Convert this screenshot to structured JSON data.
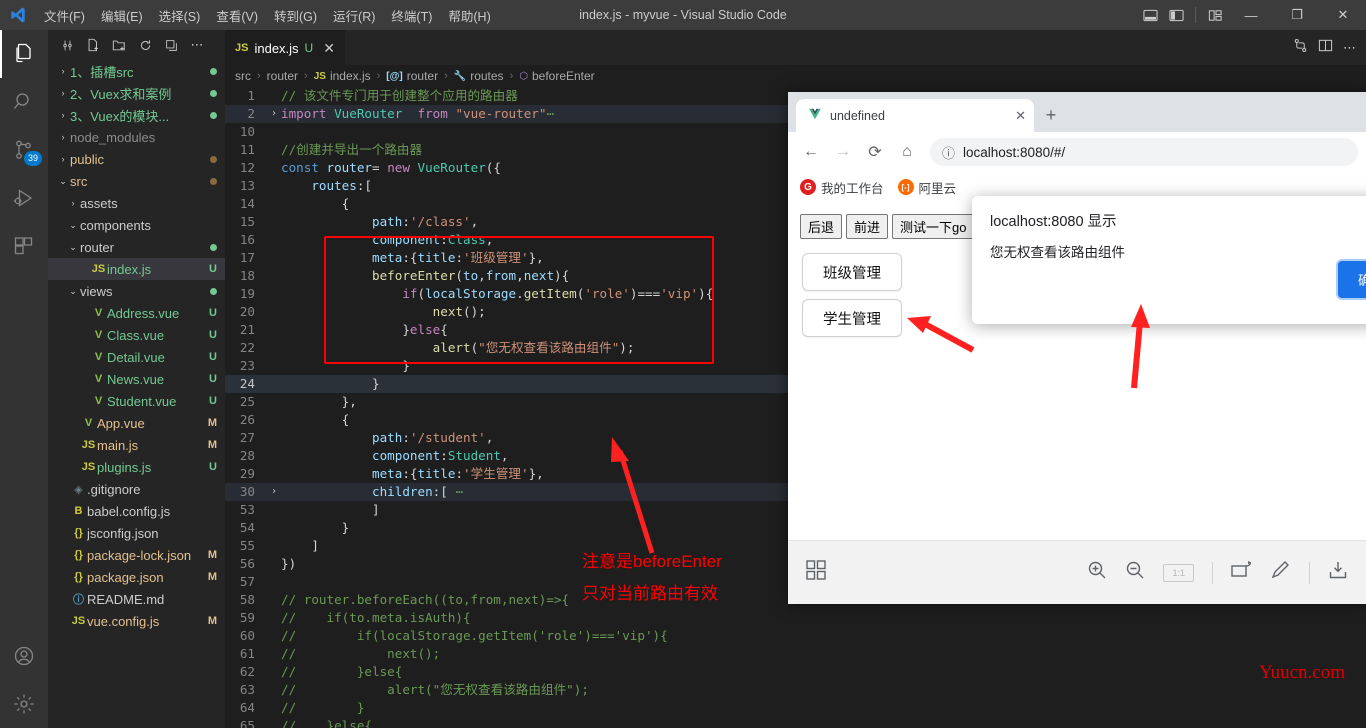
{
  "window": {
    "title": "index.js - myvue - Visual Studio Code",
    "menu": [
      "文件(F)",
      "编辑(E)",
      "选择(S)",
      "查看(V)",
      "转到(G)",
      "运行(R)",
      "终端(T)",
      "帮助(H)"
    ],
    "controls": {
      "minimize": "—",
      "maximize": "❐",
      "close": "✕"
    },
    "layout_icons": [
      "panel-layout-icon",
      "sidebar-layout-icon",
      "grid-layout-icon",
      "customize-layout-icon"
    ]
  },
  "activitybar": {
    "items": [
      {
        "name": "explorer",
        "icon": "files-icon",
        "active": true,
        "badge": ""
      },
      {
        "name": "search",
        "icon": "search-icon",
        "active": false,
        "badge": ""
      },
      {
        "name": "source-control",
        "icon": "source-control-icon",
        "active": false,
        "badge": "39"
      },
      {
        "name": "run-and-debug",
        "icon": "run-debug-icon",
        "active": false,
        "badge": ""
      },
      {
        "name": "extensions",
        "icon": "extensions-icon",
        "active": false,
        "badge": ""
      }
    ],
    "bottom": [
      {
        "name": "accounts",
        "icon": "account-icon"
      },
      {
        "name": "settings",
        "icon": "gear-icon"
      }
    ]
  },
  "sidebar": {
    "toolbar_icons": [
      "collapse-icon",
      "new-file-icon",
      "new-folder-icon",
      "refresh-icon",
      "collapse-all-icon",
      "more-actions-icon"
    ],
    "tree": [
      {
        "indent": 0,
        "chev": "›",
        "icon": "",
        "icon_color": "",
        "name": "1、插槽src",
        "name_color": "#73c991",
        "status": "",
        "dot": "#73c991"
      },
      {
        "indent": 0,
        "chev": "›",
        "icon": "",
        "icon_color": "",
        "name": "2、Vuex求和案例",
        "name_color": "#73c991",
        "status": "",
        "dot": "#73c991"
      },
      {
        "indent": 0,
        "chev": "›",
        "icon": "",
        "icon_color": "",
        "name": "3、Vuex的模块...",
        "name_color": "#73c991",
        "status": "",
        "dot": "#73c991"
      },
      {
        "indent": 0,
        "chev": "›",
        "icon": "",
        "icon_color": "",
        "name": "node_modules",
        "name_color": "#8c8c8c",
        "status": "",
        "dot": ""
      },
      {
        "indent": 0,
        "chev": "›",
        "icon": "",
        "icon_color": "",
        "name": "public",
        "name_color": "#e2c08d",
        "status": "",
        "dot": "#8c6a3f"
      },
      {
        "indent": 0,
        "chev": "⌄",
        "icon": "",
        "icon_color": "",
        "name": "src",
        "name_color": "#e2c08d",
        "status": "",
        "dot": "#8c6a3f"
      },
      {
        "indent": 1,
        "chev": "›",
        "icon": "",
        "icon_color": "",
        "name": "assets",
        "name_color": "#cccccc",
        "status": "",
        "dot": ""
      },
      {
        "indent": 1,
        "chev": "⌄",
        "icon": "",
        "icon_color": "",
        "name": "components",
        "name_color": "#cccccc",
        "status": "",
        "dot": ""
      },
      {
        "indent": 1,
        "chev": "⌄",
        "icon": "",
        "icon_color": "",
        "name": "router",
        "name_color": "#cccccc",
        "status": "",
        "dot": "#73c991"
      },
      {
        "indent": 2,
        "chev": "",
        "icon": "JS",
        "icon_color": "#cbcb41",
        "name": "index.js",
        "name_color": "#73c991",
        "status": "U",
        "status_color": "#73c991",
        "dot": "",
        "selected": true
      },
      {
        "indent": 1,
        "chev": "⌄",
        "icon": "",
        "icon_color": "",
        "name": "views",
        "name_color": "#cccccc",
        "status": "",
        "dot": "#73c991"
      },
      {
        "indent": 2,
        "chev": "",
        "icon": "V",
        "icon_color": "#8dc149",
        "name": "Address.vue",
        "name_color": "#73c991",
        "status": "U",
        "status_color": "#73c991",
        "dot": ""
      },
      {
        "indent": 2,
        "chev": "",
        "icon": "V",
        "icon_color": "#8dc149",
        "name": "Class.vue",
        "name_color": "#73c991",
        "status": "U",
        "status_color": "#73c991",
        "dot": ""
      },
      {
        "indent": 2,
        "chev": "",
        "icon": "V",
        "icon_color": "#8dc149",
        "name": "Detail.vue",
        "name_color": "#73c991",
        "status": "U",
        "status_color": "#73c991",
        "dot": ""
      },
      {
        "indent": 2,
        "chev": "",
        "icon": "V",
        "icon_color": "#8dc149",
        "name": "News.vue",
        "name_color": "#73c991",
        "status": "U",
        "status_color": "#73c991",
        "dot": ""
      },
      {
        "indent": 2,
        "chev": "",
        "icon": "V",
        "icon_color": "#8dc149",
        "name": "Student.vue",
        "name_color": "#73c991",
        "status": "U",
        "status_color": "#73c991",
        "dot": ""
      },
      {
        "indent": 1,
        "chev": "",
        "icon": "V",
        "icon_color": "#8dc149",
        "name": "App.vue",
        "name_color": "#e2c08d",
        "status": "M",
        "status_color": "#e2c08d",
        "dot": ""
      },
      {
        "indent": 1,
        "chev": "",
        "icon": "JS",
        "icon_color": "#cbcb41",
        "name": "main.js",
        "name_color": "#e2c08d",
        "status": "M",
        "status_color": "#e2c08d",
        "dot": ""
      },
      {
        "indent": 1,
        "chev": "",
        "icon": "JS",
        "icon_color": "#cbcb41",
        "name": "plugins.js",
        "name_color": "#73c991",
        "status": "U",
        "status_color": "#73c991",
        "dot": ""
      },
      {
        "indent": 0,
        "chev": "",
        "icon": "◈",
        "icon_color": "#6d8086",
        "name": ".gitignore",
        "name_color": "#cccccc",
        "status": "",
        "dot": ""
      },
      {
        "indent": 0,
        "chev": "",
        "icon": "B",
        "icon_color": "#cbcb41",
        "name": "babel.config.js",
        "name_color": "#cccccc",
        "status": "",
        "dot": ""
      },
      {
        "indent": 0,
        "chev": "",
        "icon": "{}",
        "icon_color": "#cbcb41",
        "name": "jsconfig.json",
        "name_color": "#cccccc",
        "status": "",
        "dot": ""
      },
      {
        "indent": 0,
        "chev": "",
        "icon": "{}",
        "icon_color": "#cbcb41",
        "name": "package-lock.json",
        "name_color": "#e2c08d",
        "status": "M",
        "status_color": "#e2c08d",
        "dot": ""
      },
      {
        "indent": 0,
        "chev": "",
        "icon": "{}",
        "icon_color": "#cbcb41",
        "name": "package.json",
        "name_color": "#e2c08d",
        "status": "M",
        "status_color": "#e2c08d",
        "dot": ""
      },
      {
        "indent": 0,
        "chev": "",
        "icon": "ⓘ",
        "icon_color": "#519aba",
        "name": "README.md",
        "name_color": "#cccccc",
        "status": "",
        "dot": ""
      },
      {
        "indent": 0,
        "chev": "",
        "icon": "JS",
        "icon_color": "#cbcb41",
        "name": "vue.config.js",
        "name_color": "#e2c08d",
        "status": "M",
        "status_color": "#e2c08d",
        "dot": ""
      }
    ]
  },
  "editor": {
    "tab": {
      "icon": "JS",
      "label": "index.js",
      "status": "U",
      "close": "✕"
    },
    "tab_actions": [
      "split-editor-icon",
      "more-actions-icon",
      "source-control-icon"
    ],
    "breadcrumb": [
      {
        "icon": "",
        "label": "src"
      },
      {
        "icon": "",
        "label": "router"
      },
      {
        "icon": "JS",
        "label": "index.js"
      },
      {
        "icon": "[@]",
        "label": "router"
      },
      {
        "icon": "🔧",
        "label": "routes"
      },
      {
        "icon": "⬡",
        "label": "beforeEnter"
      }
    ],
    "lines": [
      {
        "no": "1",
        "fold": "",
        "html": "<span class='c-com'>// 该文件专门用于创建整个应用的路由器</span>"
      },
      {
        "no": "2",
        "fold": "›",
        "hl": true,
        "html": "<span class='c-key'>import</span> <span class='c-cls'>VueRouter</span>  <span class='c-key'>from</span> <span class='c-str'>\"vue-router\"</span><span class='c-com'>⋯</span>"
      },
      {
        "no": "10",
        "fold": "",
        "html": ""
      },
      {
        "no": "11",
        "fold": "",
        "html": "<span class='c-com'>//创建并导出一个路由器</span>"
      },
      {
        "no": "12",
        "fold": "",
        "html": "<span class='c-kw2'>const</span> <span class='c-var'>router</span><span class='c-pun'>=</span> <span class='c-key'>new</span> <span class='c-cls'>VueRouter</span><span class='c-pun'>({</span>"
      },
      {
        "no": "13",
        "fold": "",
        "html": "    <span class='c-var'>routes</span><span class='c-pun'>:[</span>"
      },
      {
        "no": "14",
        "fold": "",
        "html": "        <span class='c-pun'>{</span>"
      },
      {
        "no": "15",
        "fold": "",
        "html": "            <span class='c-var'>path</span><span class='c-pun'>:</span><span class='c-str'>'/class'</span><span class='c-pun'>,</span>"
      },
      {
        "no": "16",
        "fold": "",
        "html": "            <span class='c-var'>component</span><span class='c-pun'>:</span><span class='c-cls'>Class</span><span class='c-pun'>,</span>"
      },
      {
        "no": "17",
        "fold": "",
        "html": "            <span class='c-var'>meta</span><span class='c-pun'>:{</span><span class='c-var'>title</span><span class='c-pun'>:</span><span class='c-str'>'班级管理'</span><span class='c-pun'>},</span>"
      },
      {
        "no": "18",
        "fold": "",
        "html": "            <span class='c-fn'>beforeEnter</span><span class='c-pun'>(</span><span class='c-var'>to</span><span class='c-pun'>,</span><span class='c-var'>from</span><span class='c-pun'>,</span><span class='c-var'>next</span><span class='c-pun'>){</span>"
      },
      {
        "no": "19",
        "fold": "",
        "html": "                <span class='c-key'>if</span><span class='c-pun'>(</span><span class='c-var'>localStorage</span><span class='c-pun'>.</span><span class='c-fn'>getItem</span><span class='c-pun'>(</span><span class='c-str'>'role'</span><span class='c-pun'>)===</span><span class='c-str'>'vip'</span><span class='c-pun'>){</span>"
      },
      {
        "no": "20",
        "fold": "",
        "html": "                    <span class='c-fn'>next</span><span class='c-pun'>();</span>"
      },
      {
        "no": "21",
        "fold": "",
        "html": "                <span class='c-pun'>}</span><span class='c-key'>else</span><span class='c-pun'>{</span>"
      },
      {
        "no": "22",
        "fold": "",
        "html": "                    <span class='c-fn'>alert</span><span class='c-pun'>(</span><span class='c-str'>\"您无权查看该路由组件\"</span><span class='c-pun'>);</span>"
      },
      {
        "no": "23",
        "fold": "",
        "html": "                <span class='c-pun'>}</span>"
      },
      {
        "no": "24",
        "fold": "",
        "active": true,
        "cur": true,
        "html": "            <span class='c-pun'>}</span>"
      },
      {
        "no": "25",
        "fold": "",
        "html": "        <span class='c-pun'>},</span>"
      },
      {
        "no": "26",
        "fold": "",
        "html": "        <span class='c-pun'>{</span>"
      },
      {
        "no": "27",
        "fold": "",
        "html": "            <span class='c-var'>path</span><span class='c-pun'>:</span><span class='c-str'>'/student'</span><span class='c-pun'>,</span>"
      },
      {
        "no": "28",
        "fold": "",
        "html": "            <span class='c-var'>component</span><span class='c-pun'>:</span><span class='c-cls'>Student</span><span class='c-pun'>,</span>"
      },
      {
        "no": "29",
        "fold": "",
        "html": "            <span class='c-var'>meta</span><span class='c-pun'>:{</span><span class='c-var'>title</span><span class='c-pun'>:</span><span class='c-str'>'学生管理'</span><span class='c-pun'>},</span>"
      },
      {
        "no": "30",
        "fold": "›",
        "hl": true,
        "html": "            <span class='c-var'>children</span><span class='c-pun'>:[</span> <span class='c-com'>⋯</span>"
      },
      {
        "no": "53",
        "fold": "",
        "html": "            <span class='c-pun'>]</span>"
      },
      {
        "no": "54",
        "fold": "",
        "html": "        <span class='c-pun'>}</span>"
      },
      {
        "no": "55",
        "fold": "",
        "html": "    <span class='c-pun'>]</span>"
      },
      {
        "no": "56",
        "fold": "",
        "html": "<span class='c-pun'>})</span>"
      },
      {
        "no": "57",
        "fold": "",
        "html": ""
      },
      {
        "no": "58",
        "fold": "",
        "html": "<span class='c-com'>// router.beforeEach((to,from,next)=>{</span>"
      },
      {
        "no": "59",
        "fold": "",
        "html": "<span class='c-com'>//    if(to.meta.isAuth){</span>"
      },
      {
        "no": "60",
        "fold": "",
        "html": "<span class='c-com'>//        if(localStorage.getItem('role')==='vip'){</span>"
      },
      {
        "no": "61",
        "fold": "",
        "html": "<span class='c-com'>//            next();</span>"
      },
      {
        "no": "62",
        "fold": "",
        "html": "<span class='c-com'>//        }else{</span>"
      },
      {
        "no": "63",
        "fold": "",
        "html": "<span class='c-com'>//            alert(\"您无权查看该路由组件\");</span>"
      },
      {
        "no": "64",
        "fold": "",
        "html": "<span class='c-com'>//        }</span>"
      },
      {
        "no": "65",
        "fold": "",
        "html": "<span class='c-com'>//    }else{</span>"
      }
    ]
  },
  "annotations": {
    "note_line1": "注意是beforeEnter",
    "note_line2": "只对当前路由有效",
    "watermark": "Yuucn.com"
  },
  "browser": {
    "tab": {
      "favicon": "vue-icon",
      "title": "undefined",
      "close": "✕"
    },
    "newtab_label": "+",
    "nav": {
      "back": "←",
      "forward": "→",
      "reload": "⟳",
      "home": "⌂"
    },
    "omnibox": {
      "info_icon": "ⓘ",
      "url": "localhost:8080/#/"
    },
    "bookmarks": [
      {
        "icon_text": "G",
        "icon_color": "#e02020",
        "label": "我的工作台"
      },
      {
        "icon_text": "[-]",
        "icon_color": "#ff6a00",
        "label": "阿里云"
      }
    ],
    "page": {
      "nav_buttons": [
        "后退",
        "前进",
        "测试一下go"
      ],
      "links": [
        "班级管理",
        "学生管理"
      ]
    },
    "bottombar": {
      "left_icon": "grid-icon",
      "right_icons": [
        "zoom-in-icon",
        "zoom-out-icon",
        "actual-size-icon",
        "rotate-icon",
        "edit-icon",
        "save-icon"
      ],
      "ratio_label": "1:1"
    },
    "dialog": {
      "title": "localhost:8080 显示",
      "message": "您无权查看该路由组件",
      "ok_label": "确定"
    }
  }
}
